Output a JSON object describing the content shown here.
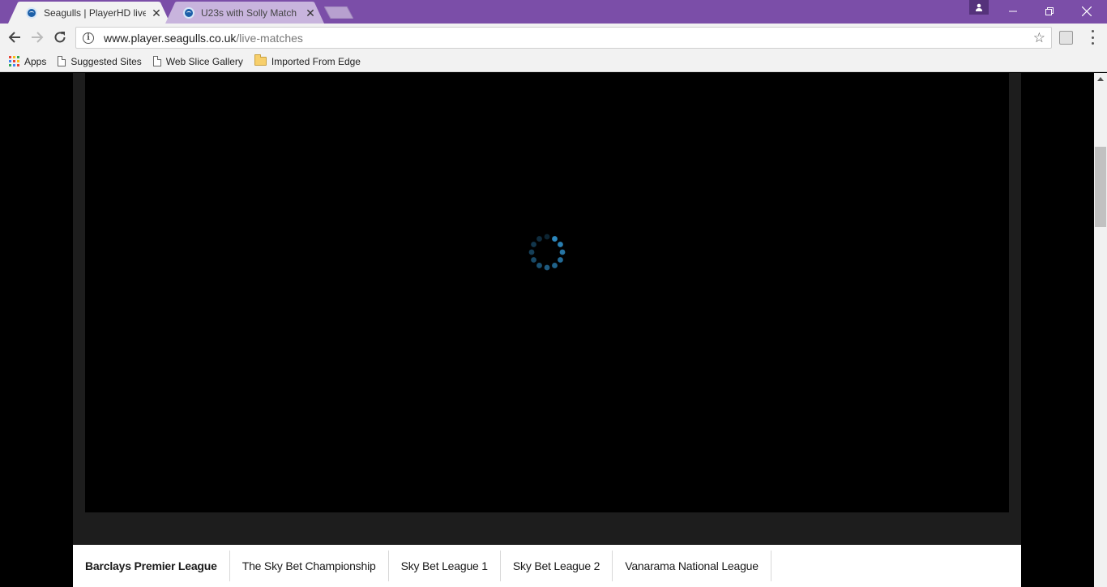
{
  "browser": {
    "tabs": [
      {
        "title": "Seagulls | PlayerHD live",
        "active": true
      },
      {
        "title": "U23s with Solly Match live",
        "active": false
      }
    ],
    "address": {
      "host": "www.player.seagulls.co.uk",
      "path": "/live-matches"
    },
    "bookmarks": [
      {
        "label": "Apps",
        "icon": "apps-grid-icon"
      },
      {
        "label": "Suggested Sites",
        "icon": "page-icon"
      },
      {
        "label": "Web Slice Gallery",
        "icon": "page-icon"
      },
      {
        "label": "Imported From Edge",
        "icon": "folder-icon"
      }
    ],
    "titlebar_color": "#7b4ea8"
  },
  "player": {
    "state": "loading",
    "spinner_color": "#2f8fc9"
  },
  "leagues": {
    "tabs": [
      {
        "label": "Barclays Premier League",
        "active": true
      },
      {
        "label": "The Sky Bet Championship",
        "active": false
      },
      {
        "label": "Sky Bet League 1",
        "active": false
      },
      {
        "label": "Sky Bet League 2",
        "active": false
      },
      {
        "label": "Vanarama National League",
        "active": false
      }
    ]
  }
}
